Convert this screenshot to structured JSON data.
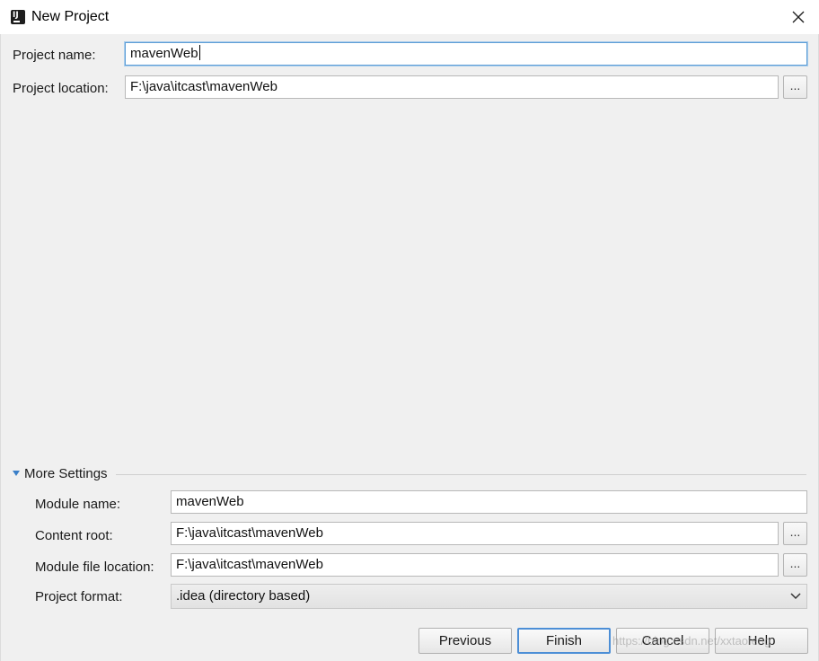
{
  "window": {
    "title": "New Project",
    "app_icon_text": "IJ"
  },
  "project": {
    "name_label": "Project name:",
    "name_value": "mavenWeb",
    "location_label": "Project location:",
    "location_value": "F:\\java\\itcast\\mavenWeb",
    "browse_label": "..."
  },
  "more_settings": {
    "header": "More Settings",
    "expanded": true,
    "module_name_label": "Module name:",
    "module_name_value": "mavenWeb",
    "content_root_label": "Content root:",
    "content_root_value": "F:\\java\\itcast\\mavenWeb",
    "module_file_location_label": "Module file location:",
    "module_file_location_value": "F:\\java\\itcast\\mavenWeb",
    "project_format_label": "Project format:",
    "project_format_value": ".idea (directory based)",
    "browse_label": "..."
  },
  "buttons": {
    "previous": "Previous",
    "finish": "Finish",
    "cancel": "Cancel",
    "help": "Help"
  },
  "watermark": "https://blog.csdn.net/xxtaofeng",
  "colors": {
    "accent": "#4c8ed6",
    "focus_border": "#5e9ed6",
    "triangle": "#3a7fc8"
  }
}
